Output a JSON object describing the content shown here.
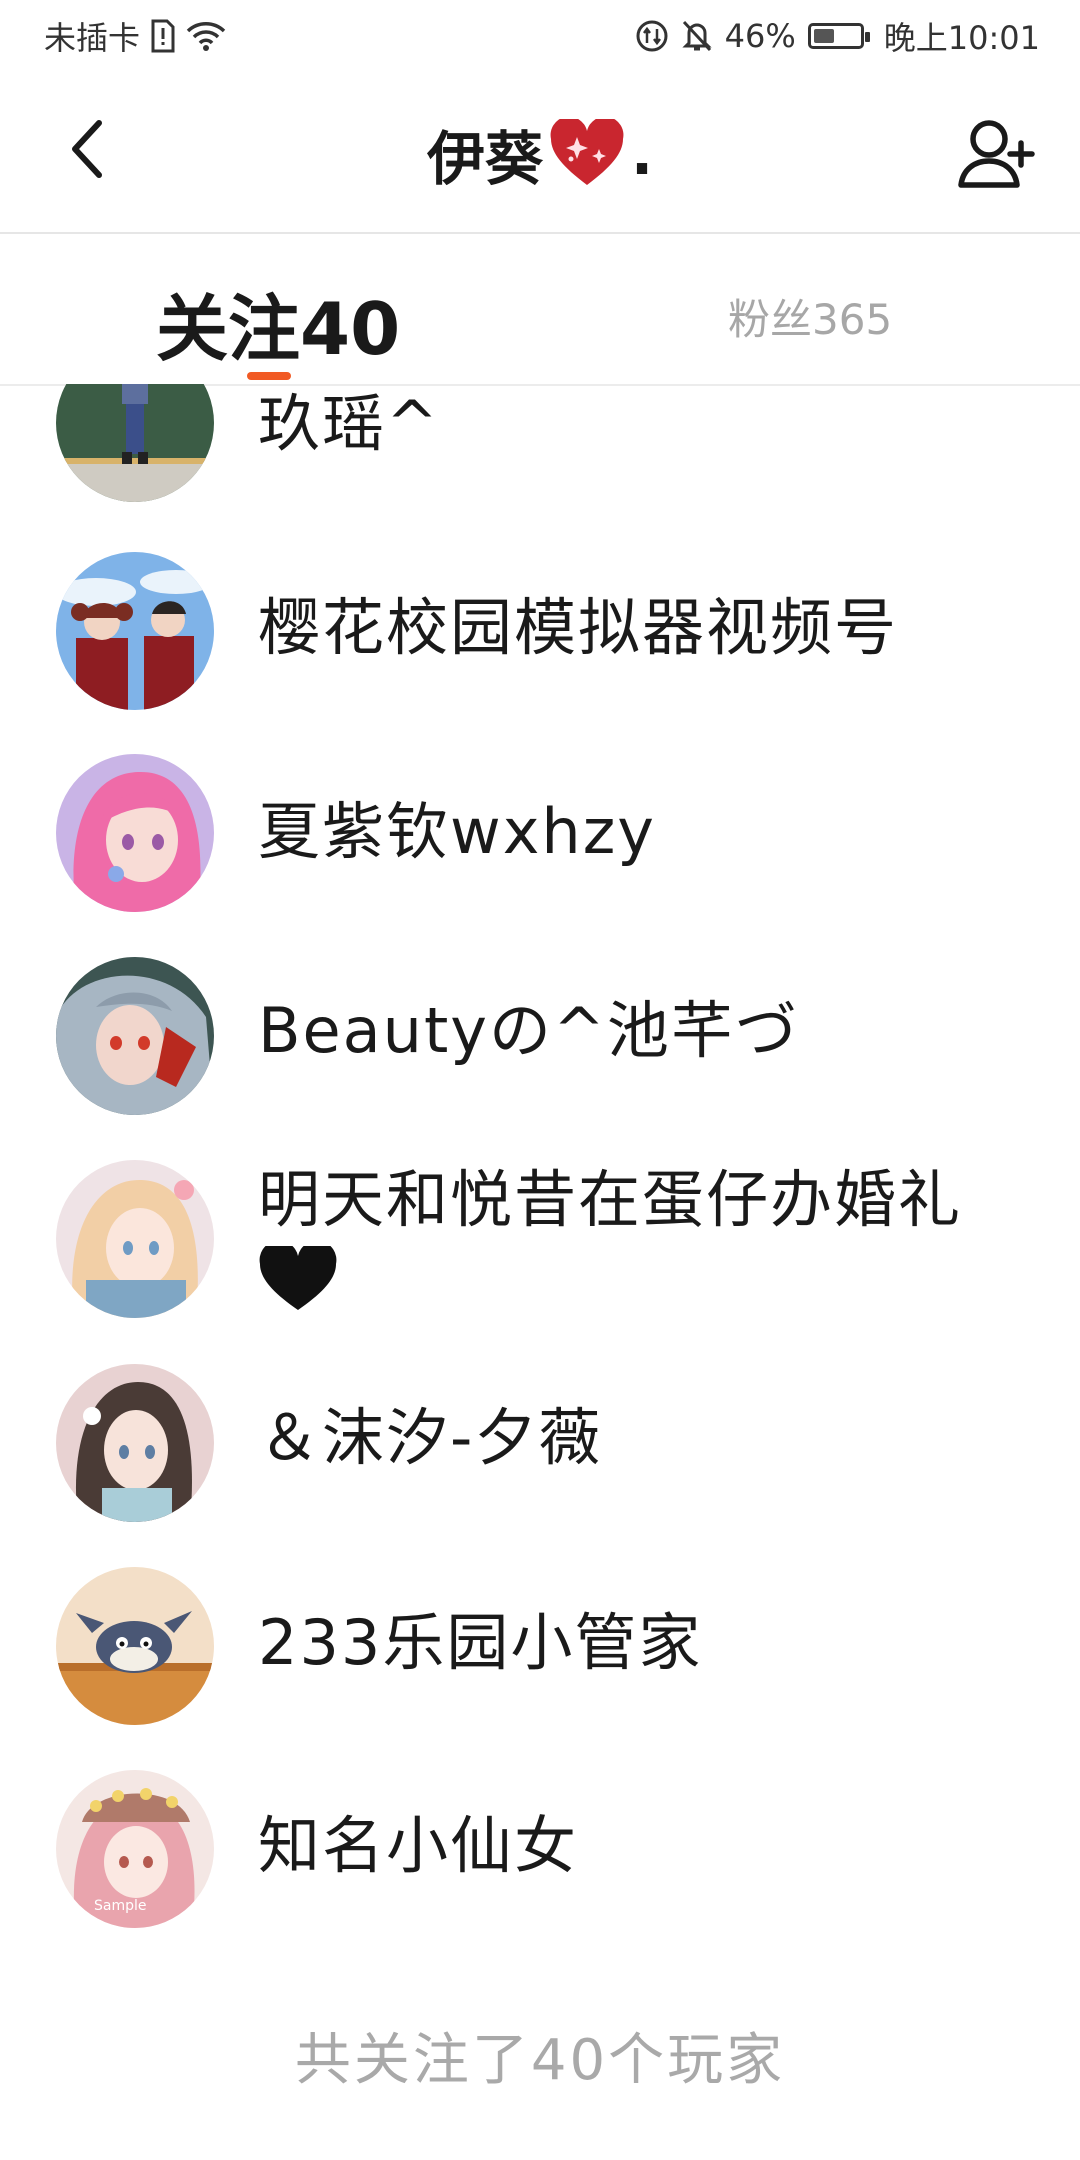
{
  "status_bar": {
    "carrier": "未插卡",
    "battery_percent": "46%",
    "battery_level": 0.46,
    "time": "晚上10:01",
    "icons": [
      "sim-alert-icon",
      "wifi-icon",
      "data-saver-icon",
      "mute-bell-icon",
      "battery-icon"
    ]
  },
  "header": {
    "title": "伊葵",
    "title_suffix": ".",
    "title_emoji": "sparkle-heart-icon",
    "back_icon": "chevron-left-icon",
    "add_user_icon": "add-user-icon"
  },
  "tabs": {
    "following_label": "关注40",
    "fans_label": "粉丝365"
  },
  "following_list": [
    {
      "name": "玖瑶^",
      "avatar": "anime-girl-classroom"
    },
    {
      "name": "樱花校园模拟器视频号",
      "avatar": "anime-couple-school"
    },
    {
      "name": "夏紫钦wxhzy",
      "avatar": "anime-pink-hair-girl"
    },
    {
      "name": "Beautyの^池芊づ",
      "avatar": "anime-silver-hair-girl"
    },
    {
      "name": "明天和悦昔在蛋仔办婚礼",
      "avatar": "anime-blonde-girl",
      "suffix_icon": "black-heart-icon"
    },
    {
      "name": "＆沫汐-夕薇",
      "avatar": "anime-brown-hair-girl"
    },
    {
      "name": "233乐园小管家",
      "avatar": "cartoon-cat"
    },
    {
      "name": "知名小仙女",
      "avatar": "anime-doll-girl",
      "avatar_watermark": "Sample"
    }
  ],
  "footer": {
    "summary": "共关注了40个玩家"
  },
  "colors": {
    "accent": "#f15a24",
    "muted_text": "#a7a7a7",
    "primary_text": "#1a1a1a"
  }
}
